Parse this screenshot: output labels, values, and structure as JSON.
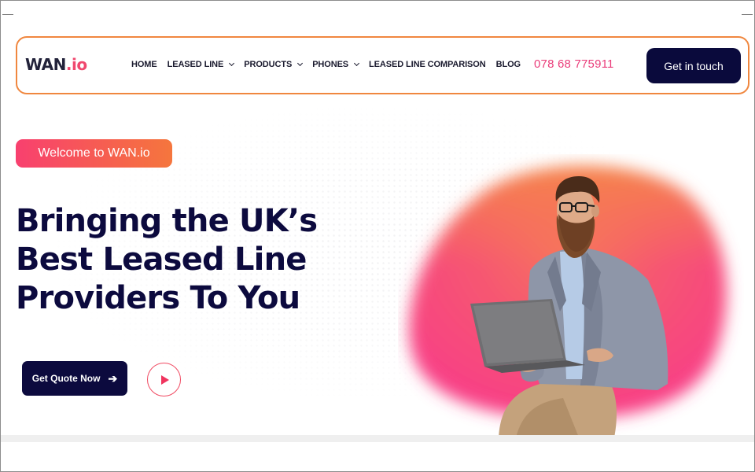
{
  "brand": {
    "name": "WAN",
    "suffix": ".io"
  },
  "nav": {
    "items": [
      {
        "label": "HOME",
        "has_dropdown": false
      },
      {
        "label": "LEASED LINE",
        "has_dropdown": true
      },
      {
        "label": "PRODUCTS",
        "has_dropdown": true
      },
      {
        "label": "PHONES",
        "has_dropdown": true
      },
      {
        "label": "LEASED LINE COMPARISON",
        "has_dropdown": false
      },
      {
        "label": "BLOG",
        "has_dropdown": false
      }
    ],
    "phone": "078 68 775911",
    "cta_label": "Get in touch"
  },
  "hero": {
    "badge": "Welcome to WAN.io",
    "headline_lines": [
      "Bringing the UK’s",
      "Best Leased Line",
      "Providers To You"
    ],
    "quote_button": "Get Quote Now",
    "quote_arrow_icon": "arrow-right-icon",
    "play_icon": "play-icon"
  },
  "colors": {
    "navy": "#0c0a3e",
    "pink": "#f0486e",
    "orange": "#f0873f",
    "phone_pink": "#ea3d7a"
  }
}
